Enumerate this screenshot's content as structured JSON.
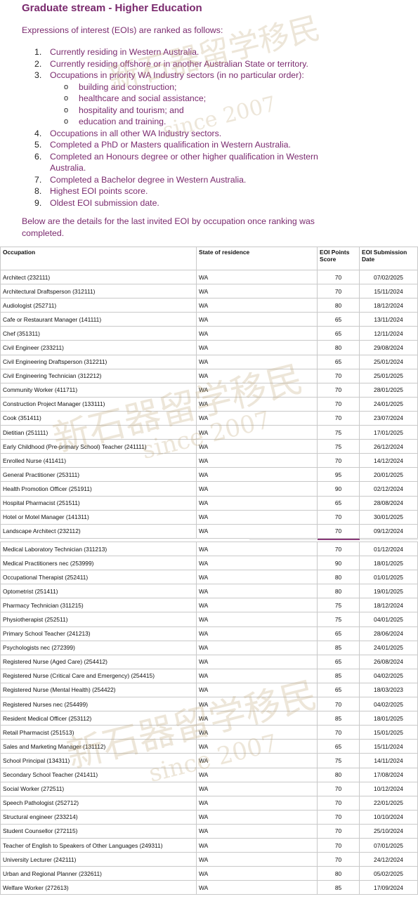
{
  "heading": "Graduate stream - Higher Education",
  "intro": "Expressions of interest (EOIs) are ranked as follows:",
  "ranking": [
    {
      "num": "1.",
      "text": "Currently residing in Western Australia."
    },
    {
      "num": "2.",
      "text": "Currently residing offshore or in another Australian State or territory."
    },
    {
      "num": "3.",
      "text": "Occupations in priority WA Industry sectors (in no particular order):",
      "sub": [
        "building and construction;",
        "healthcare and social assistance;",
        "hospitality and tourism; and",
        "education and training."
      ]
    },
    {
      "num": "4.",
      "text": "Occupations in all other WA Industry sectors."
    },
    {
      "num": "5.",
      "text": "Completed a PhD or Masters qualification in Western Australia."
    },
    {
      "num": "6.",
      "text": "Completed an Honours degree or other higher qualification in Western Australia."
    },
    {
      "num": "7.",
      "text": "Completed a Bachelor degree in Western Australia."
    },
    {
      "num": "8.",
      "text": "Highest EOI points score."
    },
    {
      "num": "9.",
      "text": "Oldest EOI submission date."
    }
  ],
  "sub_bullet": "o",
  "details": "Below are the details for the last invited EOI by occupation once ranking was completed.",
  "watermark": {
    "chars": "新石器留学移民",
    "since": "since 2007"
  },
  "table": {
    "headers": {
      "occupation": "Occupation",
      "state": "State of residence",
      "score": "EOI Points Score",
      "date": "EOI Submission Date"
    },
    "rows_top": [
      [
        "Architect (232111)",
        "WA",
        "70",
        "07/02/2025"
      ],
      [
        "Architectural Draftsperson (312111)",
        "WA",
        "70",
        "15/11/2024"
      ],
      [
        "Audiologist (252711)",
        "WA",
        "80",
        "18/12/2024"
      ],
      [
        "Cafe or Restaurant Manager (141111)",
        "WA",
        "65",
        "13/11/2024"
      ],
      [
        "Chef (351311)",
        "WA",
        "65",
        "12/11/2024"
      ],
      [
        "Civil Engineer (233211)",
        "WA",
        "80",
        "29/08/2024"
      ],
      [
        "Civil Engineering Draftsperson (312211)",
        "WA",
        "65",
        "25/01/2024"
      ],
      [
        "Civil Engineering Technician (312212)",
        "WA",
        "70",
        "25/01/2025"
      ],
      [
        "Community Worker (411711)",
        "WA",
        "70",
        "28/01/2025"
      ],
      [
        "Construction Project Manager (133111)",
        "WA",
        "70",
        "24/01/2025"
      ],
      [
        "Cook (351411)",
        "WA",
        "70",
        "23/07/2024"
      ],
      [
        "Dietitian (251111)",
        "WA",
        "75",
        "17/01/2025"
      ],
      [
        "Early Childhood (Pre-primary School) Teacher (241111)",
        "WA",
        "75",
        "26/12/2024"
      ],
      [
        "Enrolled Nurse (411411)",
        "WA",
        "70",
        "14/12/2024"
      ],
      [
        "General Practitioner (253111)",
        "WA",
        "95",
        "20/01/2025"
      ],
      [
        "Health Promotion Officer (251911)",
        "WA",
        "90",
        "02/12/2024"
      ],
      [
        "Hospital Pharmacist (251511)",
        "WA",
        "65",
        "28/08/2024"
      ],
      [
        "Hotel or Motel Manager (141311)",
        "WA",
        "70",
        "30/01/2025"
      ],
      [
        "Landscape Architect (232112)",
        "WA",
        "70",
        "09/12/2024"
      ]
    ],
    "rows_bottom": [
      [
        "Medical Laboratory Technician (311213)",
        "WA",
        "70",
        "01/12/2024"
      ],
      [
        "Medical Practitioners nec (253999)",
        "WA",
        "90",
        "18/01/2025"
      ],
      [
        "Occupational Therapist (252411)",
        "WA",
        "80",
        "01/01/2025"
      ],
      [
        "Optometrist (251411)",
        "WA",
        "80",
        "19/01/2025"
      ],
      [
        "Pharmacy Technician (311215)",
        "WA",
        "75",
        "18/12/2024"
      ],
      [
        "Physiotherapist (252511)",
        "WA",
        "75",
        "04/01/2025"
      ],
      [
        "Primary School Teacher (241213)",
        "WA",
        "65",
        "28/06/2024"
      ],
      [
        "Psychologists nec (272399)",
        "WA",
        "85",
        "24/01/2025"
      ],
      [
        "Registered Nurse (Aged Care) (254412)",
        "WA",
        "65",
        "26/08/2024"
      ],
      [
        "Registered Nurse (Critical Care and Emergency) (254415)",
        "WA",
        "85",
        "04/02/2025"
      ],
      [
        "Registered Nurse (Mental Health) (254422)",
        "WA",
        "65",
        "18/03/2023"
      ],
      [
        "Registered Nurses nec (254499)",
        "WA",
        "70",
        "04/02/2025"
      ],
      [
        "Resident Medical Officer (253112)",
        "WA",
        "85",
        "18/01/2025"
      ],
      [
        "Retail Pharmacist (251513)",
        "WA",
        "70",
        "15/01/2025"
      ],
      [
        "Sales and Marketing Manager (131112)",
        "WA",
        "65",
        "15/11/2024"
      ],
      [
        "School Principal (134311)",
        "WA",
        "75",
        "14/11/2024"
      ],
      [
        "Secondary School Teacher (241411)",
        "WA",
        "80",
        "17/08/2024"
      ],
      [
        "Social Worker (272511)",
        "WA",
        "70",
        "10/12/2024"
      ],
      [
        "Speech Pathologist (252712)",
        "WA",
        "70",
        "22/01/2025"
      ],
      [
        "Structural engineer (233214)",
        "WA",
        "70",
        "10/10/2024"
      ],
      [
        "Student Counsellor (272115)",
        "WA",
        "70",
        "25/10/2024"
      ],
      [
        "Teacher of English to Speakers of Other Languages (249311)",
        "WA",
        "70",
        "07/01/2025"
      ],
      [
        "University Lecturer (242111)",
        "WA",
        "70",
        "24/12/2024"
      ],
      [
        "Urban and Regional Planner (232611)",
        "WA",
        "80",
        "05/02/2025"
      ],
      [
        "Welfare Worker (272613)",
        "WA",
        "85",
        "17/09/2024"
      ]
    ]
  }
}
